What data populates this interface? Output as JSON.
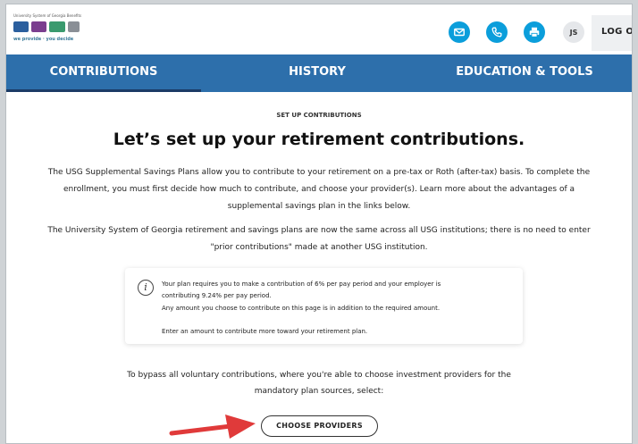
{
  "header": {
    "logo": {
      "title": "University System of Georgia Benefits",
      "tagline": "we provide · you decide",
      "colors": [
        "#2b5f9e",
        "#7a3e8f",
        "#3a9a6e",
        "#8a8f96"
      ]
    },
    "icons": [
      {
        "name": "email-icon",
        "color": "#0b9edb"
      },
      {
        "name": "phone-icon",
        "color": "#0b9edb"
      },
      {
        "name": "print-icon",
        "color": "#0b9edb"
      }
    ],
    "user_initials": "JS",
    "logout_label": "LOG OU"
  },
  "nav": {
    "tabs": [
      {
        "label": "CONTRIBUTIONS",
        "active": true
      },
      {
        "label": "HISTORY",
        "active": false
      },
      {
        "label": "EDUCATION & TOOLS",
        "active": false
      }
    ],
    "colors": {
      "bar": "#2d6fab",
      "active_underline": "#1b3b66"
    }
  },
  "main": {
    "eyebrow": "SET UP CONTRIBUTIONS",
    "heading": "Let’s set up your retirement contributions.",
    "intro_lines": [
      "The USG Supplemental Savings Plans allow you to contribute to your retirement on a pre-tax or Roth (after-tax) basis. To complete the",
      "enrollment, you must first decide how much to contribute, and choose your provider(s). Learn more about the advantages of a",
      "supplemental savings plan in the links below."
    ],
    "system_lines": [
      "The University System of Georgia retirement and savings plans are now the same across all USG institutions; there is no need to enter",
      "\"prior contributions\" made at another USG institution."
    ],
    "notice": {
      "line1": "Your plan requires you to make a contribution of 6% per pay period and your employer is",
      "line2": "contributing 9.24% per pay period.",
      "line3": "Any amount you choose to contribute on this page is in addition to the required amount.",
      "line4": "Enter an amount to contribute more toward your retirement plan."
    },
    "bypass_lines": [
      "To bypass all voluntary contributions, where you're able to choose investment providers for the",
      "mandatory plan sources, select:"
    ],
    "choose_providers_label": "CHOOSE PROVIDERS",
    "annotation_arrow_color": "#e03a3a"
  }
}
